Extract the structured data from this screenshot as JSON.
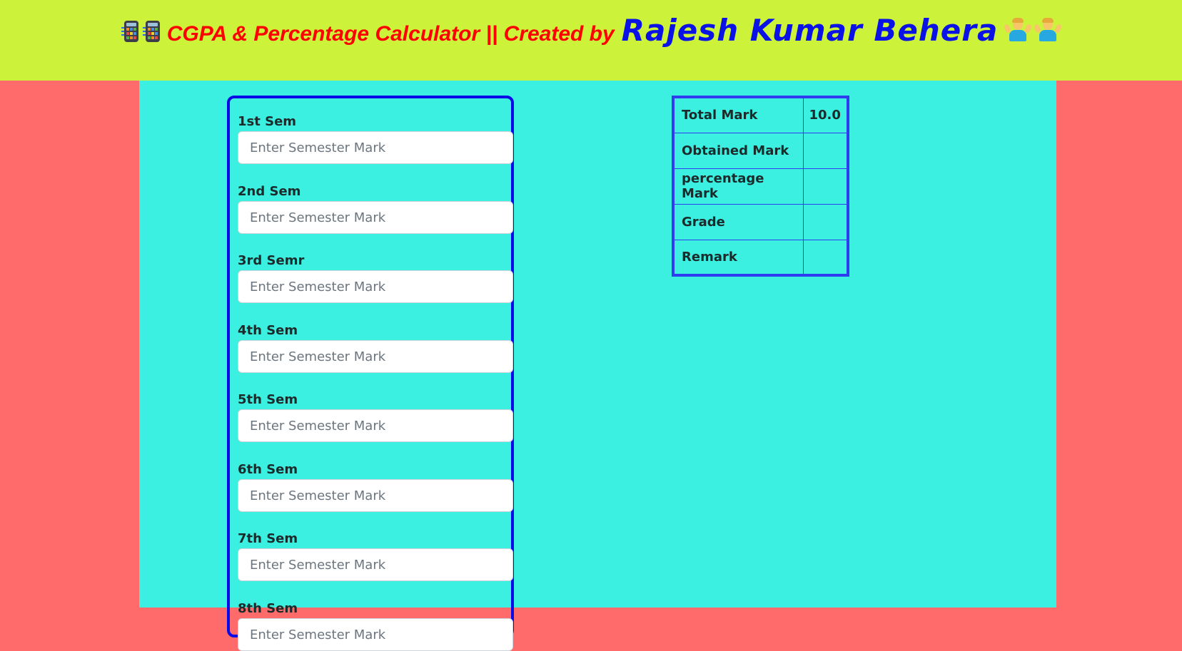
{
  "header": {
    "title_main": "CGPA & Percentage Calculator || Created by",
    "author": "Rajesh Kumar Behera",
    "icons": [
      "abacus-calculator-icon",
      "abacus-calculator-icon",
      "person-shrugging-icon",
      "person-shrugging-icon"
    ]
  },
  "colors": {
    "header_bg": "#cdf23a",
    "page_bg": "#ff6b6b",
    "main_bg": "#3bf0e0",
    "title_red": "#ff0000",
    "title_blue": "#0a12e6",
    "panel_border": "#0a0ae6",
    "table_border": "#2f3cf0"
  },
  "semesters": [
    {
      "label": "1st Sem",
      "placeholder": "Enter Semester Mark"
    },
    {
      "label": "2nd Sem",
      "placeholder": "Enter Semester Mark"
    },
    {
      "label": "3rd Semr",
      "placeholder": "Enter Semester Mark"
    },
    {
      "label": "4th Sem",
      "placeholder": "Enter Semester Mark"
    },
    {
      "label": "5th Sem",
      "placeholder": "Enter Semester Mark"
    },
    {
      "label": "6th Sem",
      "placeholder": "Enter Semester Mark"
    },
    {
      "label": "7th Sem",
      "placeholder": "Enter Semester Mark"
    },
    {
      "label": "8th Sem",
      "placeholder": "Enter Semester Mark"
    }
  ],
  "results": [
    {
      "label": "Total Mark",
      "value": "10.0"
    },
    {
      "label": "Obtained Mark",
      "value": ""
    },
    {
      "label": "percentage Mark",
      "value": ""
    },
    {
      "label": "Grade",
      "value": ""
    },
    {
      "label": "Remark",
      "value": ""
    }
  ]
}
